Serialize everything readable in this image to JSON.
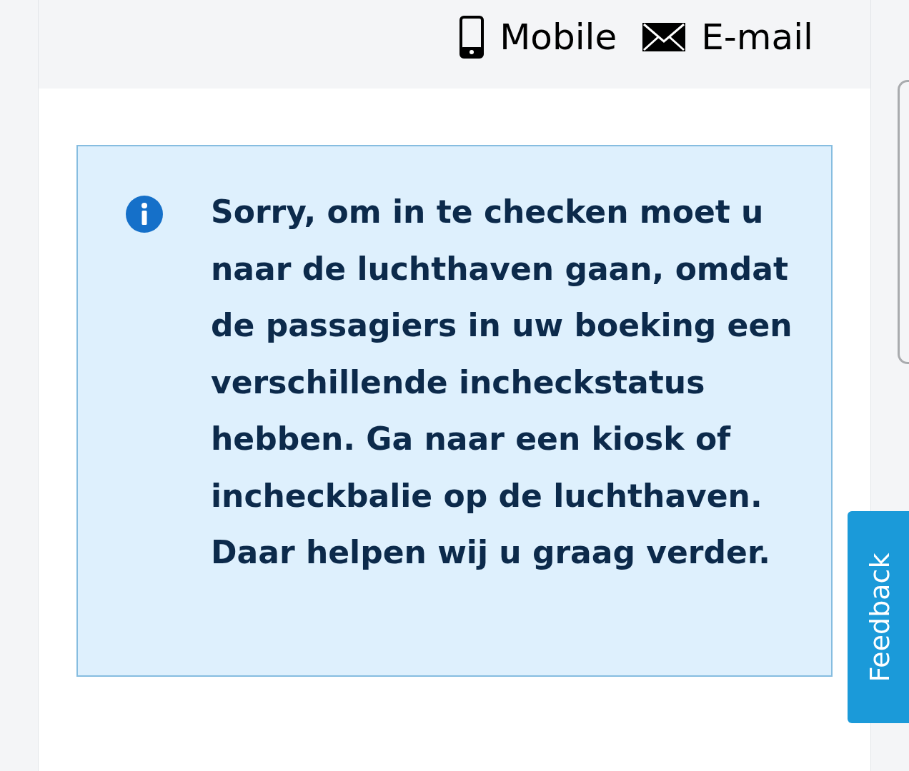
{
  "contact_options": [
    {
      "kind": "mobile",
      "label": "Mobile"
    },
    {
      "kind": "email",
      "label": "E-mail"
    }
  ],
  "notice": {
    "kind": "info",
    "message": "Sorry, om in te checken moet u naar de luchthaven gaan, omdat de passagiers in uw boeking een verschillende incheckstatus hebben. Ga naar een kiosk of incheckbalie op de luchthaven. Daar helpen wij u graag verder."
  },
  "feedback_tab": {
    "label": "Feedback"
  }
}
